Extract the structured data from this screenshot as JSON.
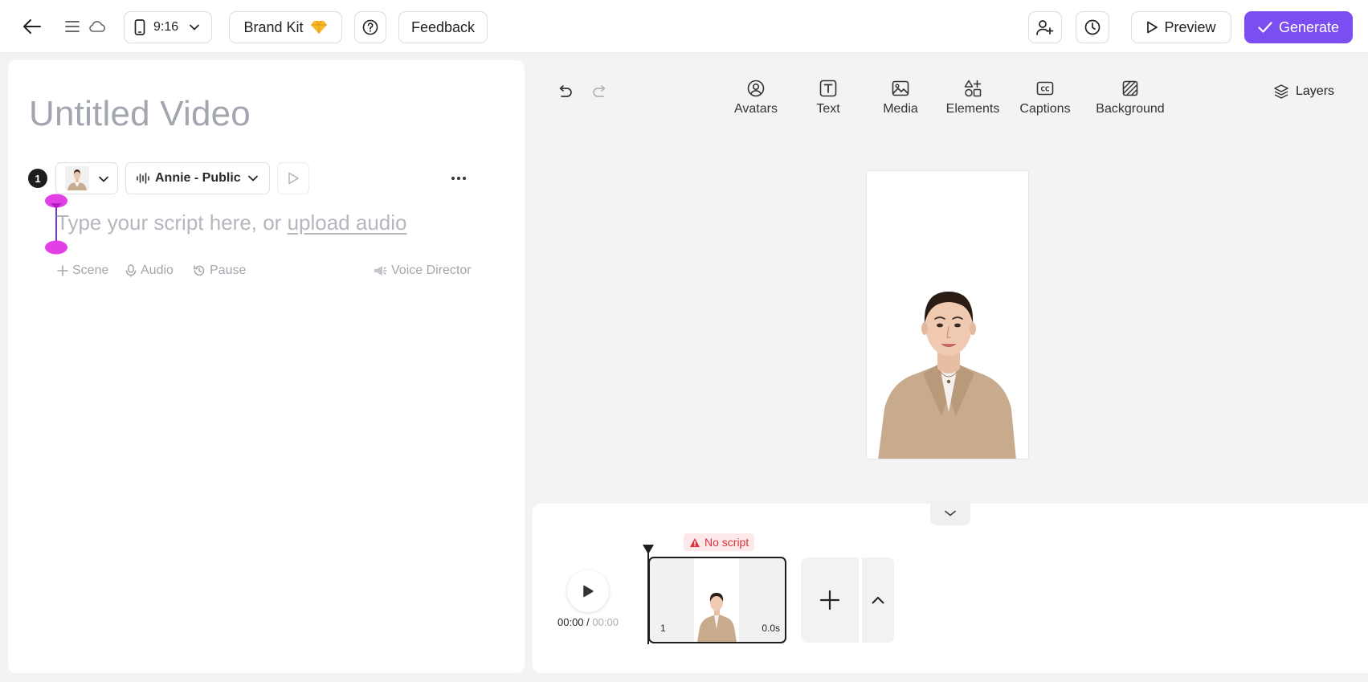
{
  "header": {
    "aspect_ratio": "9:16",
    "brand_kit_label": "Brand Kit",
    "feedback_label": "Feedback",
    "preview_label": "Preview",
    "generate_label": "Generate",
    "accent_color": "#7b4ef2"
  },
  "editor": {
    "video_title": "Untitled Video",
    "scene_number": "1",
    "voice_name": "Annie - Public",
    "script_placeholder": "Type your script here, or ",
    "upload_audio_link": "upload audio",
    "actions": {
      "scene": "Scene",
      "audio": "Audio",
      "pause": "Pause",
      "voice_director": "Voice Director"
    }
  },
  "toolbar": {
    "items": [
      {
        "label": "Avatars",
        "icon": "avatar-icon"
      },
      {
        "label": "Text",
        "icon": "text-icon"
      },
      {
        "label": "Media",
        "icon": "media-icon"
      },
      {
        "label": "Elements",
        "icon": "elements-icon"
      },
      {
        "label": "Captions",
        "icon": "captions-icon"
      },
      {
        "label": "Background",
        "icon": "background-icon"
      }
    ],
    "layers_label": "Layers"
  },
  "timeline": {
    "current_time": "00:00",
    "separator": " / ",
    "total_time": "00:00",
    "warning": "No script",
    "scene_index": "1",
    "scene_duration": "0.0s"
  }
}
